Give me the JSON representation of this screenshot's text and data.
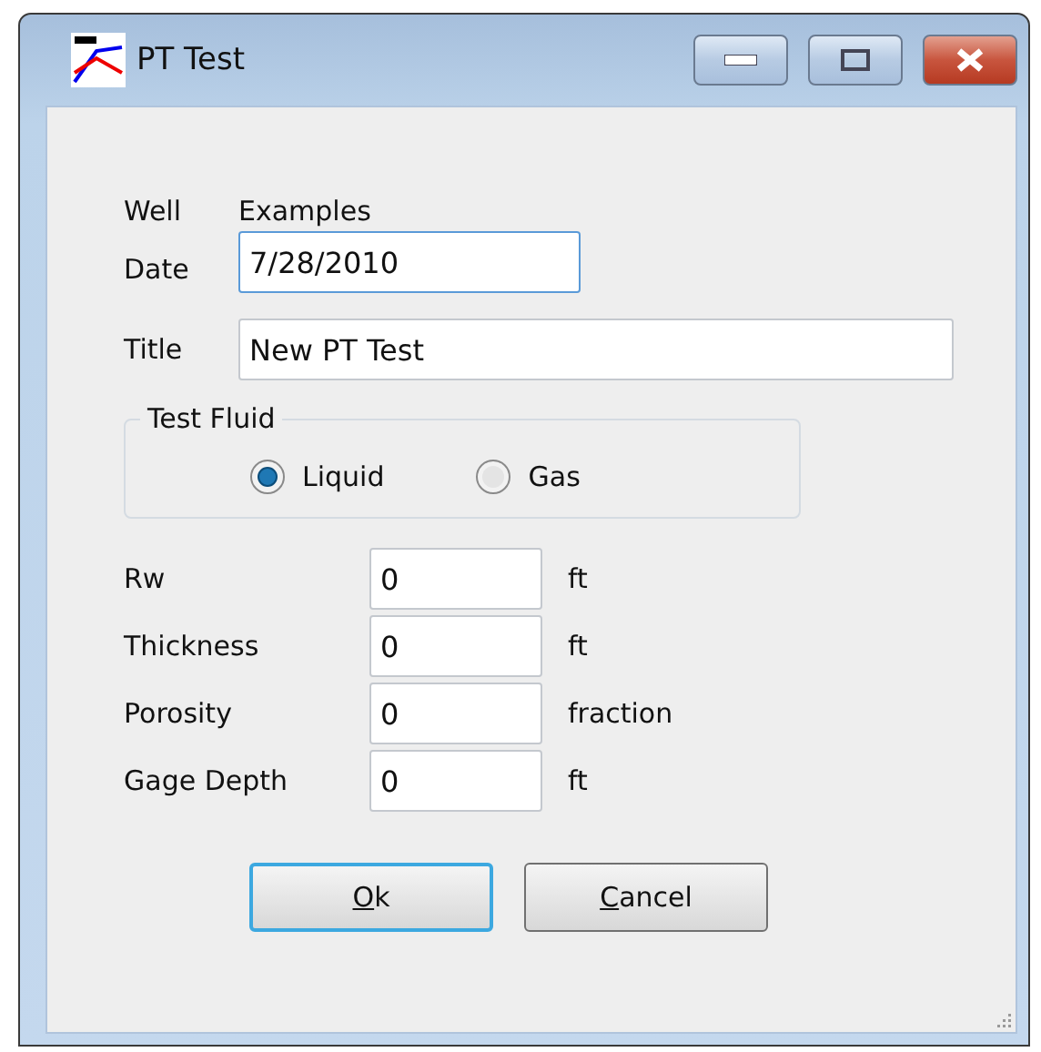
{
  "window": {
    "title": "PT Test"
  },
  "well": {
    "label": "Well",
    "value": "Examples"
  },
  "date": {
    "label": "Date",
    "value": "7/28/2010",
    "focused": true
  },
  "title_field": {
    "label": "Title",
    "value": "New PT Test",
    "focused": false
  },
  "test_fluid": {
    "legend": "Test Fluid",
    "options": [
      {
        "label": "Liquid",
        "selected": true
      },
      {
        "label": "Gas",
        "selected": false
      }
    ]
  },
  "parameters": [
    {
      "label": "Rw",
      "value": "0",
      "unit": "ft"
    },
    {
      "label": "Thickness",
      "value": "0",
      "unit": "ft"
    },
    {
      "label": "Porosity",
      "value": "0",
      "unit": "fraction"
    },
    {
      "label": "Gage Depth",
      "value": "0",
      "unit": "ft"
    }
  ],
  "buttons": [
    {
      "parts": [
        {
          "text": "O",
          "underlined": true
        },
        {
          "text": "k",
          "underlined": false
        }
      ],
      "default": true
    },
    {
      "parts": [
        {
          "text": "C",
          "underlined": true
        },
        {
          "text": "ancel",
          "underlined": false
        }
      ],
      "default": false
    }
  ]
}
